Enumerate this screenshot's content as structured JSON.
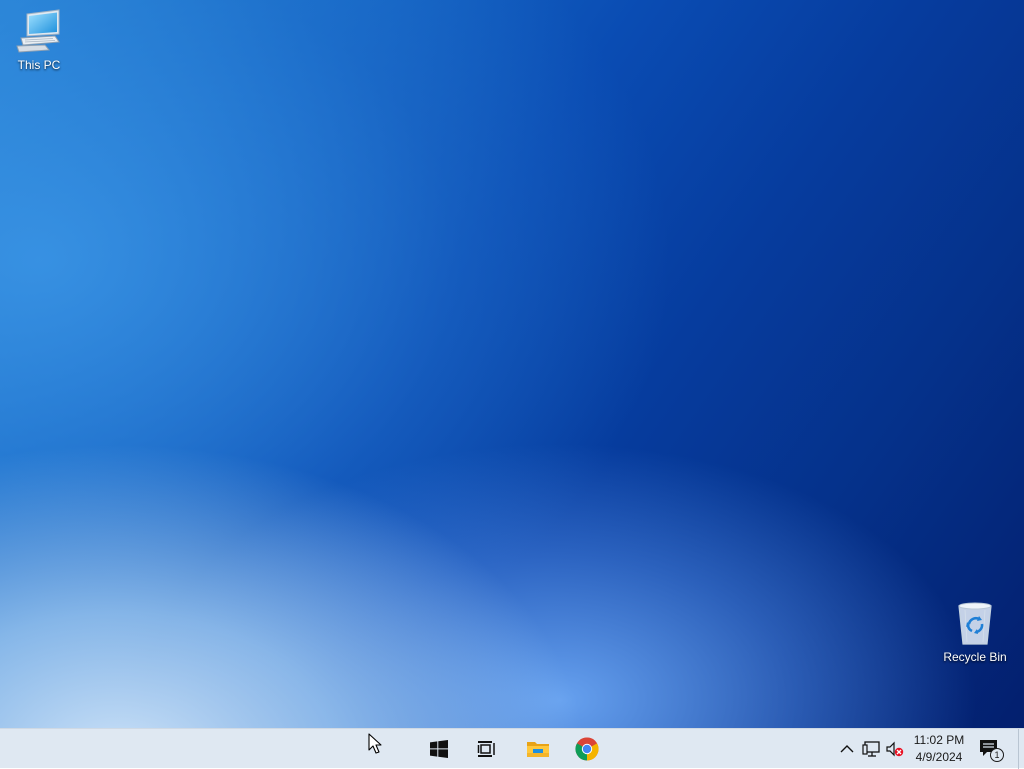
{
  "desktop": {
    "icons": [
      {
        "label": "This PC",
        "icon": "this-pc-icon"
      },
      {
        "label": "Recycle Bin",
        "icon": "recycle-bin-icon"
      }
    ]
  },
  "taskbar": {
    "pinned": [
      {
        "name": "start",
        "icon": "windows-logo-icon"
      },
      {
        "name": "task-view",
        "icon": "task-view-icon"
      },
      {
        "name": "file-explorer",
        "icon": "folder-icon"
      },
      {
        "name": "google-chrome",
        "icon": "chrome-icon"
      }
    ],
    "tray": {
      "icons": [
        "chevron-up-icon",
        "network-icon",
        "volume-muted-icon"
      ],
      "time": "11:02 PM",
      "date": "4/9/2024",
      "notification_count": "1"
    }
  },
  "colors": {
    "taskbar_bg": "#dfe8f2",
    "wallpaper_dark": "#031f6e",
    "wallpaper_light": "#2a8ad8",
    "accent_blue": "#0078d7",
    "mute_red": "#e81123"
  }
}
